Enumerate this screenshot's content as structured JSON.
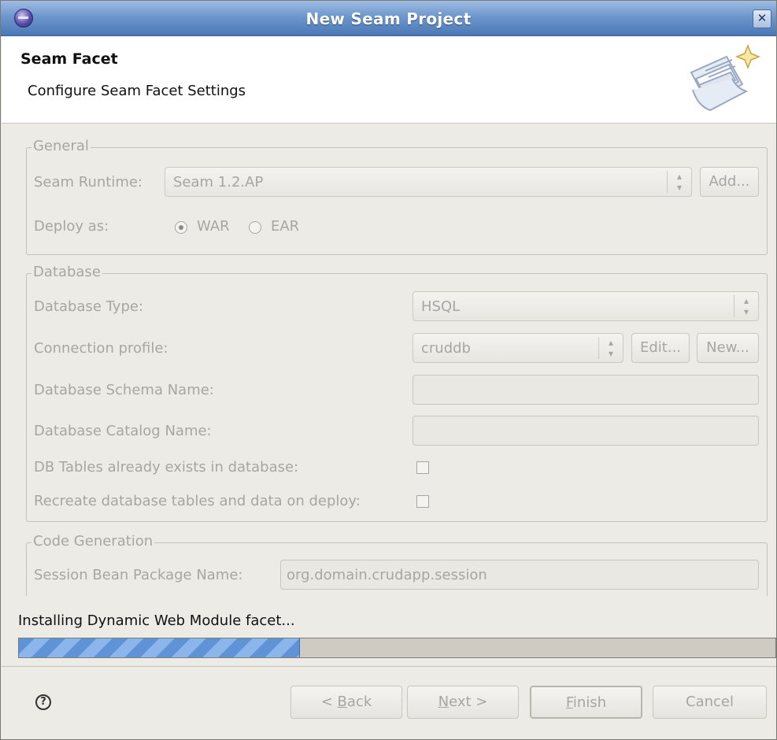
{
  "window": {
    "title": "New Seam Project"
  },
  "banner": {
    "title": "Seam Facet",
    "description": "Configure Seam Facet Settings"
  },
  "general": {
    "group_title": "General",
    "seam_runtime_label": "Seam Runtime:",
    "seam_runtime_value": "Seam 1.2.AP",
    "add_button": "Add...",
    "deploy_as_label": "Deploy as:",
    "deploy_options": [
      {
        "label": "WAR",
        "selected": true
      },
      {
        "label": "EAR",
        "selected": false
      }
    ]
  },
  "database": {
    "group_title": "Database",
    "type_label": "Database Type:",
    "type_value": "HSQL",
    "connection_label": "Connection profile:",
    "connection_value": "cruddb",
    "edit_button": "Edit...",
    "new_button": "New...",
    "schema_label": "Database Schema Name:",
    "schema_value": "",
    "catalog_label": "Database Catalog Name:",
    "catalog_value": "",
    "tables_exist_label": "DB Tables already exists in database:",
    "tables_exist_checked": false,
    "recreate_label": "Recreate database tables and data on deploy:",
    "recreate_checked": false
  },
  "code_generation": {
    "group_title": "Code Generation",
    "session_bean_label": "Session Bean Package Name:",
    "session_bean_value": "org.domain.crudapp.session"
  },
  "progress": {
    "status_text": "Installing Dynamic Web Module facet...",
    "fraction": 0.37,
    "fill_color": "#5f93d6"
  },
  "footer": {
    "help_icon": "question-mark-circle",
    "back_prefix": "< ",
    "back_mnemonic": "B",
    "back_rest": "ack",
    "next_mnemonic": "N",
    "next_rest": "ext >",
    "finish_mnemonic": "F",
    "finish_rest": "inish",
    "cancel": "Cancel"
  },
  "colors": {
    "title_bar": "#4b78b6",
    "disabled_text": "#a8a6a0",
    "window_bg": "#ecebe6"
  }
}
